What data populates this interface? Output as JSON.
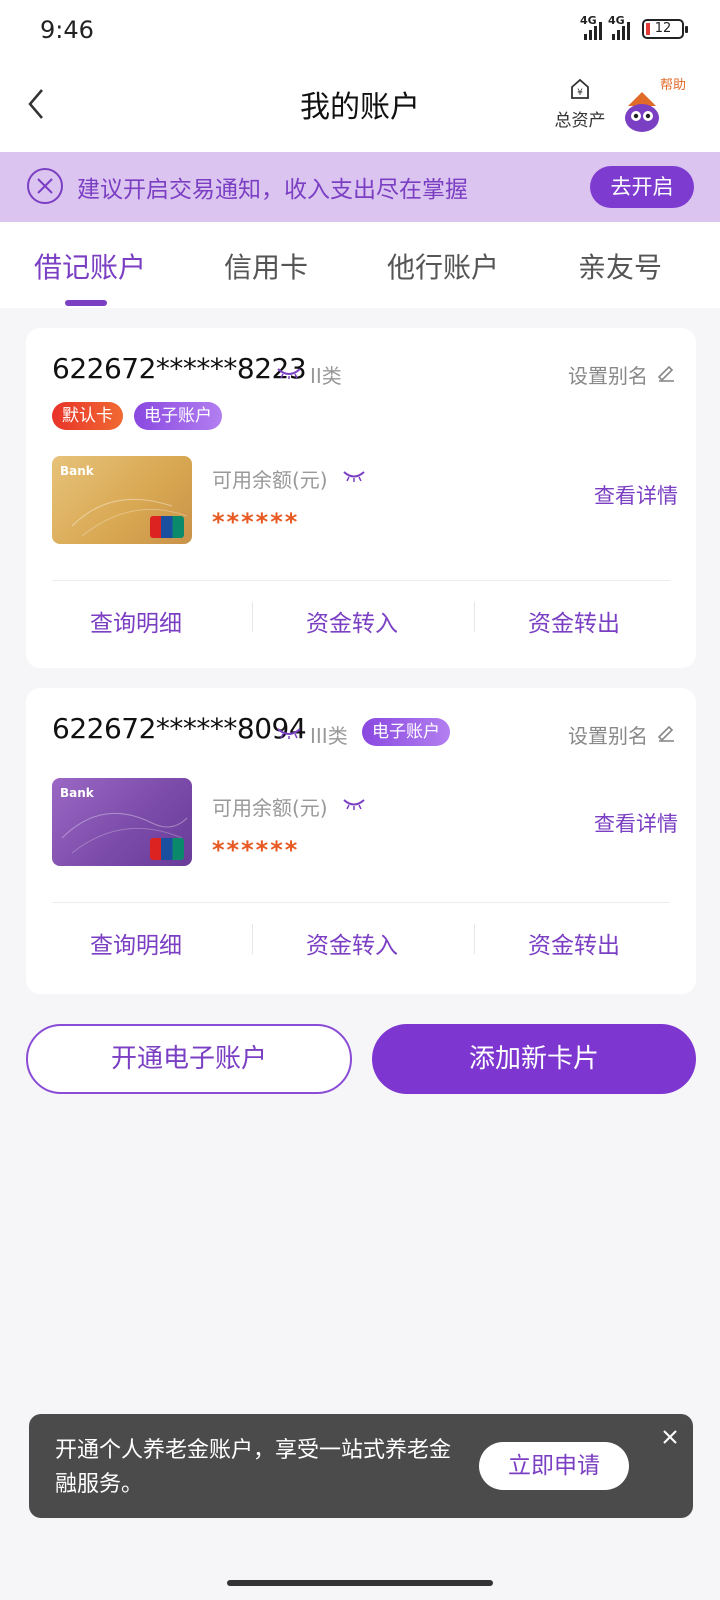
{
  "status_bar": {
    "time": "9:46",
    "net1": "4G",
    "net2": "4G",
    "battery": "12"
  },
  "nav": {
    "title": "我的账户",
    "total_assets": "总资产",
    "help": "帮助"
  },
  "notice": {
    "text": "建议开启交易通知，收入支出尽在掌握",
    "button": "去开启"
  },
  "tabs": [
    {
      "label": "借记账户",
      "active": true
    },
    {
      "label": "信用卡",
      "active": false
    },
    {
      "label": "他行账户",
      "active": false
    },
    {
      "label": "亲友号",
      "active": false
    }
  ],
  "accounts": [
    {
      "number": "622672******8223",
      "class": "II类",
      "badges": [
        "默认卡",
        "电子账户"
      ],
      "alias": "设置别名",
      "balance_label": "可用余额(元)",
      "balance": "******",
      "detail": "查看详情",
      "card_logo": "Bank",
      "actions": [
        "查询明细",
        "资金转入",
        "资金转出"
      ]
    },
    {
      "number": "622672******8094",
      "class": "III类",
      "badges": [
        "电子账户"
      ],
      "alias": "设置别名",
      "balance_label": "可用余额(元)",
      "balance": "******",
      "detail": "查看详情",
      "card_logo": "Bank",
      "actions": [
        "查询明细",
        "资金转入",
        "资金转出"
      ]
    }
  ],
  "buttons": {
    "open_e_account": "开通电子账户",
    "add_card": "添加新卡片"
  },
  "toast": {
    "message": "开通个人养老金账户，享受一站式养老金融服务。",
    "button": "立即申请"
  },
  "colors": {
    "accent": "#7b3fc3",
    "balance": "#e85a22",
    "notice_bg": "#dcc4f0"
  }
}
